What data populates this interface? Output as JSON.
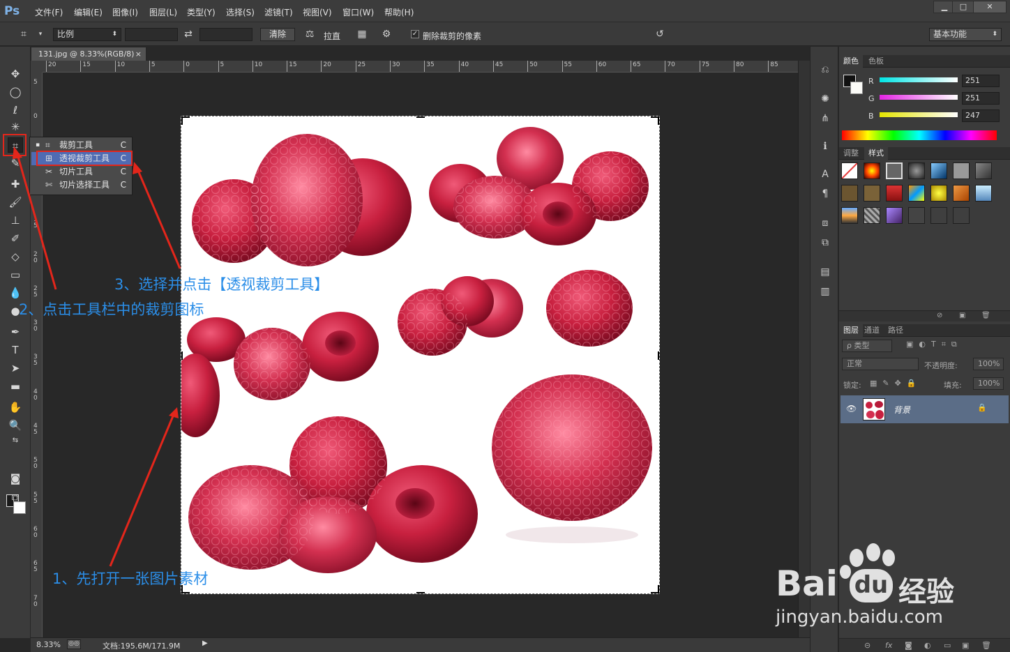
{
  "app": {
    "logo": "Ps"
  },
  "menu": [
    "文件(F)",
    "编辑(E)",
    "图像(I)",
    "图层(L)",
    "类型(Y)",
    "选择(S)",
    "滤镜(T)",
    "视图(V)",
    "窗口(W)",
    "帮助(H)"
  ],
  "window_buttons": [
    "▁",
    "□",
    "✕"
  ],
  "options": {
    "ratio_select": "比例",
    "swap_icon": "⇄",
    "clear_button": "清除",
    "straighten": "拉直",
    "delete_cropped_label": "删除裁剪的像素",
    "delete_cropped_checked": "✓",
    "workspace": "基本功能"
  },
  "flyout": {
    "items": [
      {
        "label": "裁剪工具",
        "key": "C"
      },
      {
        "label": "透视裁剪工具",
        "key": "C"
      },
      {
        "label": "切片工具",
        "key": "C"
      },
      {
        "label": "切片选择工具",
        "key": "C"
      }
    ],
    "active_marker": "▪"
  },
  "document": {
    "tab_title": "131.jpg @ 8.33%(RGB/8)",
    "tab_close": "×",
    "ruler_top": [
      "20",
      "15",
      "10",
      "5",
      "0",
      "5",
      "10",
      "15",
      "20",
      "25",
      "30",
      "35",
      "40",
      "45",
      "50",
      "55",
      "60",
      "65",
      "70",
      "75",
      "80",
      "85"
    ],
    "ruler_left": [
      "5",
      "0",
      "5",
      "1\n0",
      "1\n5",
      "2\n0",
      "2\n5",
      "3\n0",
      "3\n5",
      "4\n0",
      "4\n5",
      "5\n0",
      "5\n5",
      "6\n0",
      "6\n5",
      "7\n0"
    ]
  },
  "annotations": {
    "step1": "1、先打开一张图片素材",
    "step2": "2、点击工具栏中的裁剪图标",
    "step3": "3、选择并点击【透视裁剪工具】"
  },
  "status": {
    "zoom": "8.33%",
    "doc_info": "文档:195.6M/171.9M"
  },
  "color_panel": {
    "tabs": [
      "颜色",
      "色板"
    ],
    "channels": [
      {
        "label": "R",
        "value": "251"
      },
      {
        "label": "G",
        "value": "251"
      },
      {
        "label": "B",
        "value": "247"
      }
    ]
  },
  "styles_panel": {
    "tabs": [
      "调整",
      "样式"
    ]
  },
  "layers_panel": {
    "tabs": [
      "图层",
      "通道",
      "路径"
    ],
    "filter": "ρ 类型",
    "blend_mode": "正常",
    "opacity_label": "不透明度:",
    "opacity_value": "100%",
    "lock_label": "锁定:",
    "fill_label": "填充:",
    "fill_value": "100%",
    "layer_name": "背景",
    "footer_icons": [
      "⊝",
      "fx",
      "◙",
      "◐",
      "▭",
      "▣",
      "🗑"
    ]
  },
  "watermark": {
    "brand": "Bai",
    "brand2": "du",
    "cn": "经验",
    "url": "jingyan.baidu.com"
  },
  "colors": {
    "accent_red": "#e3261b",
    "annotation_blue": "#2b8ee8",
    "selection": "#4f6bb3"
  }
}
